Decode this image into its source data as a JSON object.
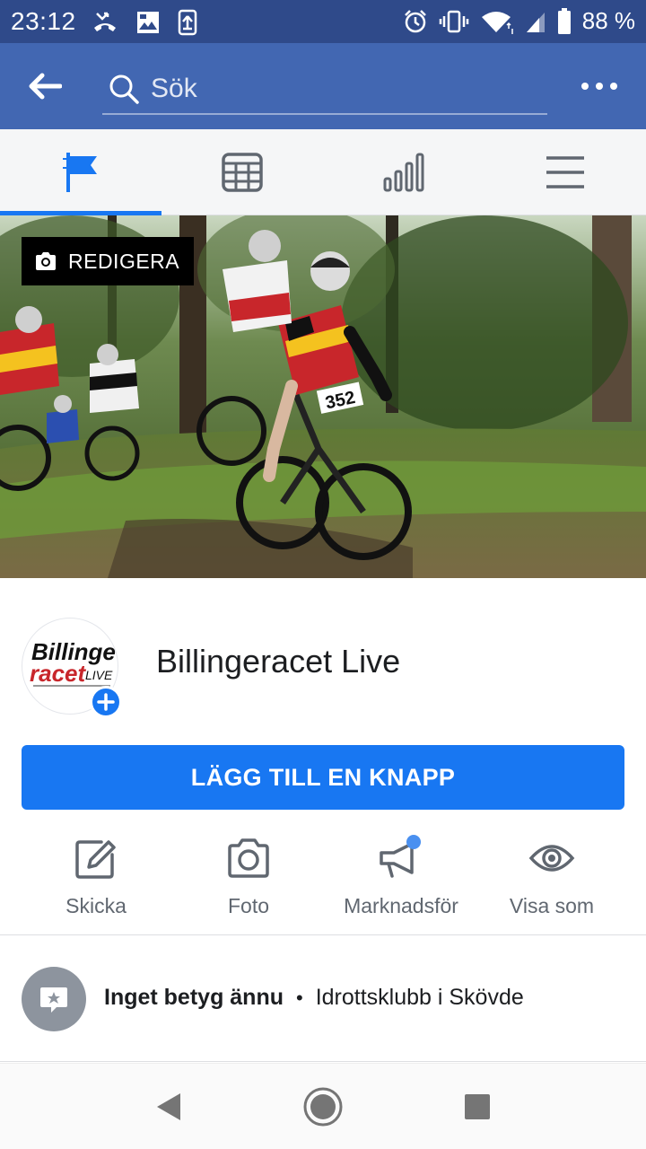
{
  "status_bar": {
    "time": "23:12",
    "battery": "88 %",
    "icons": [
      "missed-call-icon",
      "image-icon",
      "upload-icon",
      "alarm-icon",
      "vibrate-icon",
      "wifi-icon",
      "signal-icon",
      "battery-icon"
    ]
  },
  "app_bar": {
    "search_placeholder": "Sök"
  },
  "tabs": [
    {
      "name": "page",
      "icon": "flag-icon",
      "active": true
    },
    {
      "name": "events",
      "icon": "calendar-icon",
      "active": false
    },
    {
      "name": "insights",
      "icon": "bar-chart-icon",
      "active": false
    },
    {
      "name": "menu",
      "icon": "hamburger-icon",
      "active": false
    }
  ],
  "cover": {
    "edit_label": "REDIGERA"
  },
  "profile": {
    "name": "Billingeracet Live",
    "logo_text_top": "Billinge",
    "logo_text_bottom": "racet",
    "logo_text_live": "LIVE"
  },
  "add_button_label": "LÄGG TILL EN KNAPP",
  "actions": [
    {
      "label": "Skicka",
      "icon": "edit-icon"
    },
    {
      "label": "Foto",
      "icon": "camera-icon"
    },
    {
      "label": "Marknadsför",
      "icon": "megaphone-icon"
    },
    {
      "label": "Visa som",
      "icon": "eye-icon"
    }
  ],
  "rating": {
    "label": "Inget betyg ännu",
    "separator": "•",
    "category": "Idrottsklubb i Skövde"
  },
  "colors": {
    "status_bar": "#2f4a8a",
    "app_bar": "#4267b2",
    "accent": "#1877f2"
  }
}
